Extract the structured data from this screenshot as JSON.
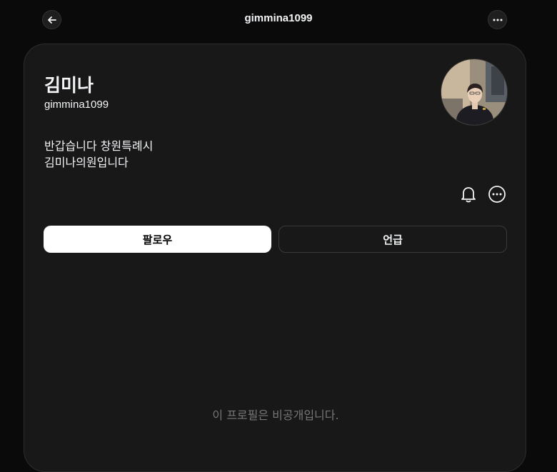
{
  "header": {
    "title": "gimmina1099",
    "back_icon": "arrow-left-icon",
    "menu_icon": "more-horizontal-icon"
  },
  "profile": {
    "name": "김미나",
    "handle": "gimmina1099",
    "bio_line1": "반갑습니다 창원특례시",
    "bio_line2": "김미나의원입니다",
    "avatar_icon": "profile-photo"
  },
  "actions": {
    "notify_icon": "bell-icon",
    "more_icon": "more-circle-icon",
    "follow_label": "팔로우",
    "mention_label": "언급"
  },
  "content": {
    "private_notice": "이 프로필은 비공개입니다."
  },
  "colors": {
    "background": "#0a0a0a",
    "card": "#181818",
    "text": "#f3f5f7",
    "muted": "#777777"
  }
}
